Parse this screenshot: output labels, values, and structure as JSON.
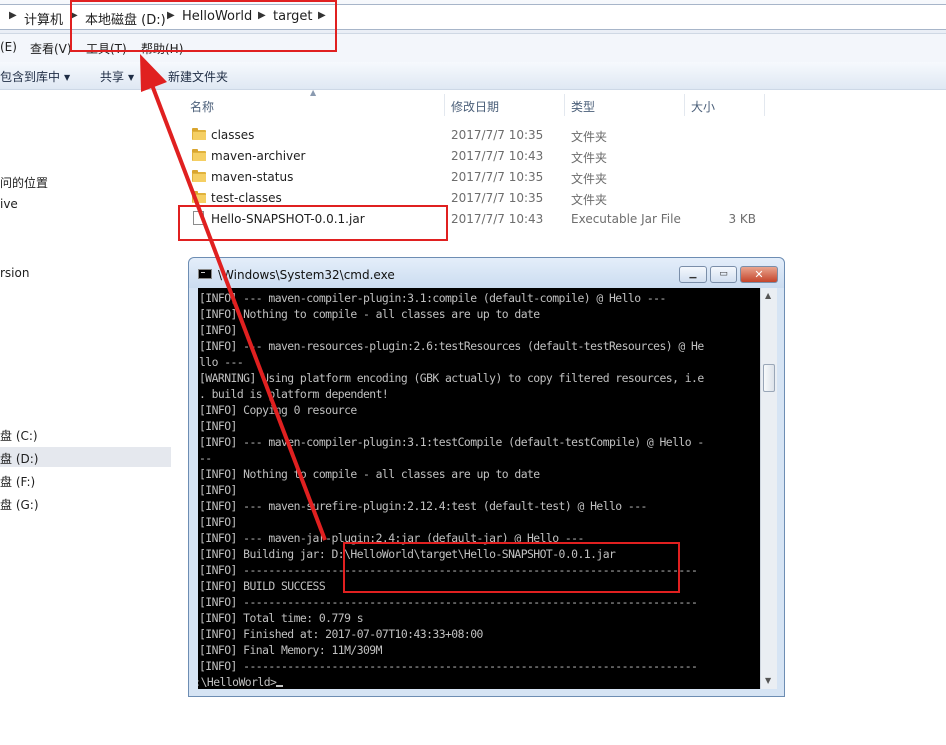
{
  "address_bar": {
    "crumbs": [
      "计算机",
      "本地磁盘 (D:)",
      "HelloWorld",
      "target"
    ]
  },
  "menu": [
    "(E)",
    "查看(V)",
    "工具(T)",
    "帮助(H)"
  ],
  "toolbar": {
    "include_library": "包含到库中",
    "share": "共享",
    "new_folder": "新建文件夹"
  },
  "nav_pane": {
    "items": [
      "问的位置",
      "ive",
      "rsion",
      "盘 (C:)",
      "盘 (D:)",
      "盘 (F:)",
      "盘 (G:)"
    ]
  },
  "columns": {
    "name": "名称",
    "date": "修改日期",
    "type": "类型",
    "size": "大小"
  },
  "files": [
    {
      "name": "classes",
      "date": "2017/7/7 10:35",
      "type": "文件夹",
      "size": ""
    },
    {
      "name": "maven-archiver",
      "date": "2017/7/7 10:43",
      "type": "文件夹",
      "size": ""
    },
    {
      "name": "maven-status",
      "date": "2017/7/7 10:35",
      "type": "文件夹",
      "size": ""
    },
    {
      "name": "test-classes",
      "date": "2017/7/7 10:35",
      "type": "文件夹",
      "size": ""
    },
    {
      "name": "Hello-SNAPSHOT-0.0.1.jar",
      "date": "2017/7/7 10:43",
      "type": "Executable Jar File",
      "size": "3 KB"
    }
  ],
  "cmd": {
    "title": "\\Windows\\System32\\cmd.exe",
    "lines": [
      "[INFO] --- maven-compiler-plugin:3.1:compile (default-compile) @ Hello ---",
      "[INFO] Nothing to compile - all classes are up to date",
      "[INFO]",
      "[INFO] --- maven-resources-plugin:2.6:testResources (default-testResources) @ He",
      "llo ---",
      "[WARNING] Using platform encoding (GBK actually) to copy filtered resources, i.e",
      ". build is platform dependent!",
      "[INFO] Copying 0 resource",
      "[INFO]",
      "[INFO] --- maven-compiler-plugin:3.1:testCompile (default-testCompile) @ Hello -",
      "--",
      "[INFO] Nothing to compile - all classes are up to date",
      "[INFO]",
      "[INFO] --- maven-surefire-plugin:2.12.4:test (default-test) @ Hello ---",
      "[INFO]",
      "[INFO] --- maven-jar-plugin:2.4:jar (default-jar) @ Hello ---",
      "[INFO] Building jar: D:\\HelloWorld\\target\\Hello-SNAPSHOT-0.0.1.jar",
      "[INFO] ------------------------------------------------------------------------",
      "[INFO] BUILD SUCCESS",
      "[INFO] ------------------------------------------------------------------------",
      "[INFO] Total time: 0.779 s",
      "[INFO] Finished at: 2017-07-07T10:43:33+08:00",
      "[INFO] Final Memory: 11M/309M",
      "[INFO] ------------------------------------------------------------------------"
    ],
    "prompt": "D:\\HelloWorld>"
  },
  "annotation_color": "#e02020"
}
